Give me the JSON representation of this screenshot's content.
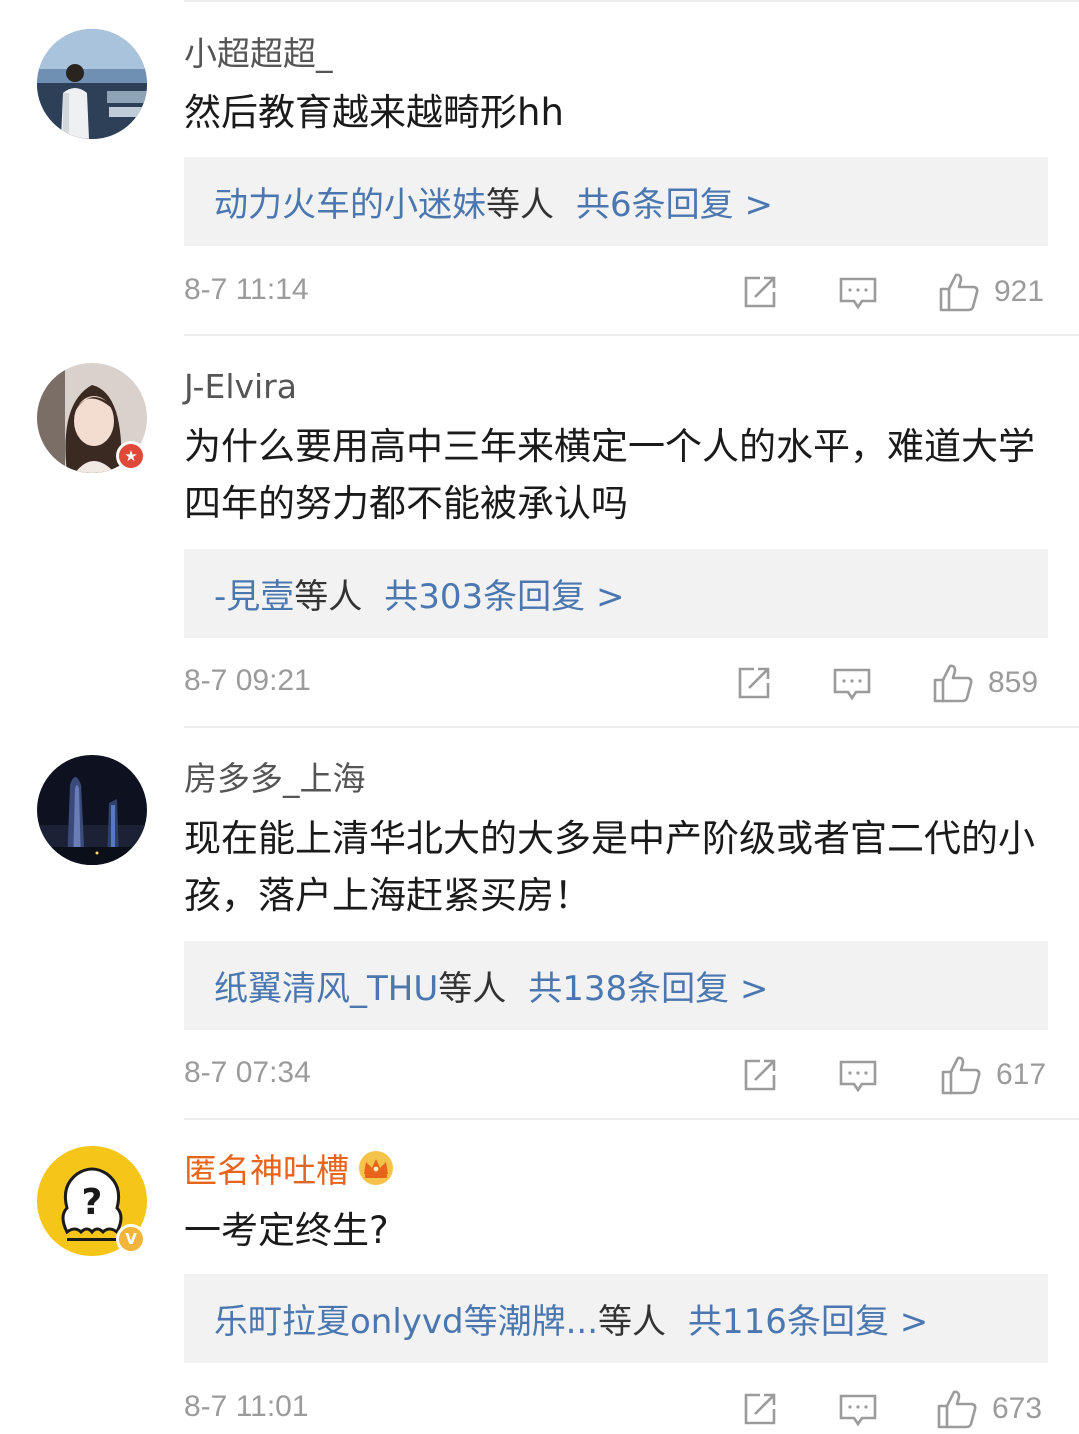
{
  "comments": [
    {
      "username": "小超超超_",
      "text": "然后教育越来越畸形hh",
      "reply_names": "动力火车的小迷妹",
      "reply_suffix": "等人",
      "reply_count": "共6条回复 >",
      "time": "8-7 11:14",
      "likes": "921"
    },
    {
      "username": "J-Elvira",
      "text": "为什么要用高中三年来横定一个人的水平，难道大学四年的努力都不能被承认吗",
      "reply_names": "-見壹",
      "reply_suffix": "等人",
      "reply_count": "共303条回复 >",
      "time": "8-7 09:21",
      "likes": "859"
    },
    {
      "username": "房多多_上海",
      "text": "现在能上清华北大的大多是中产阶级或者官二代的小孩，落户上海赶紧买房！",
      "reply_names": "纸翼清风_THU",
      "reply_suffix": "等人",
      "reply_count": "共138条回复 >",
      "time": "8-7 07:34",
      "likes": "617"
    },
    {
      "username": "匿名神吐槽",
      "text": "一考定终生?",
      "reply_names": "乐町拉夏onlyvd等潮牌...",
      "reply_suffix": "等人",
      "reply_count": "共116条回复 >",
      "time": "8-7 11:01",
      "likes": "673"
    }
  ],
  "colors": {
    "link": "#4a77b0",
    "vip_name": "#e8641b",
    "meta": "#9b9b9b",
    "reply_bg": "#f2f2f2",
    "badge_red": "#e0493a",
    "badge_gold": "#f2b43a"
  },
  "icons": {
    "repost": "share-icon",
    "comment": "comment-icon",
    "like": "thumbs-up-icon",
    "verified": "verified-v-icon",
    "vip": "star-badge-icon",
    "crown": "crown-icon"
  }
}
